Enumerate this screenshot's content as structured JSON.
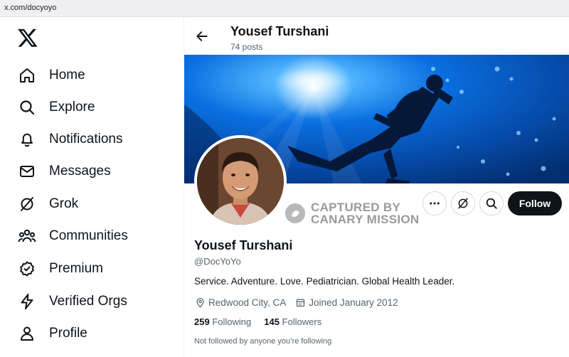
{
  "browser": {
    "url": "x.com/docyoyo"
  },
  "sidebar": {
    "logo_icon": "x-logo-icon",
    "items": [
      {
        "label": "Home",
        "icon": "home-icon"
      },
      {
        "label": "Explore",
        "icon": "search-icon"
      },
      {
        "label": "Notifications",
        "icon": "bell-icon"
      },
      {
        "label": "Messages",
        "icon": "envelope-icon"
      },
      {
        "label": "Grok",
        "icon": "grok-icon"
      },
      {
        "label": "Communities",
        "icon": "people-icon"
      },
      {
        "label": "Premium",
        "icon": "verified-badge-icon"
      },
      {
        "label": "Verified Orgs",
        "icon": "lightning-icon"
      },
      {
        "label": "Profile",
        "icon": "person-icon"
      }
    ]
  },
  "header": {
    "name": "Yousef Turshani",
    "posts": "74 posts"
  },
  "watermark": {
    "line1": "CAPTURED BY",
    "line2": "CANARY MISSION"
  },
  "actions": {
    "follow_label": "Follow"
  },
  "profile": {
    "name": "Yousef Turshani",
    "handle": "@DocYoYo",
    "bio": "Service. Adventure. Love. Pediatrician. Global Health Leader.",
    "location": "Redwood City, CA",
    "joined": "Joined January 2012",
    "following_count": "259",
    "following_label": "Following",
    "followers_count": "145",
    "followers_label": "Followers",
    "followed_by_note": "Not followed by anyone you’re following"
  },
  "colors": {
    "text": "#0f1419",
    "secondary": "#536471",
    "follow_bg": "#0f1419",
    "border": "#cfd9de"
  }
}
